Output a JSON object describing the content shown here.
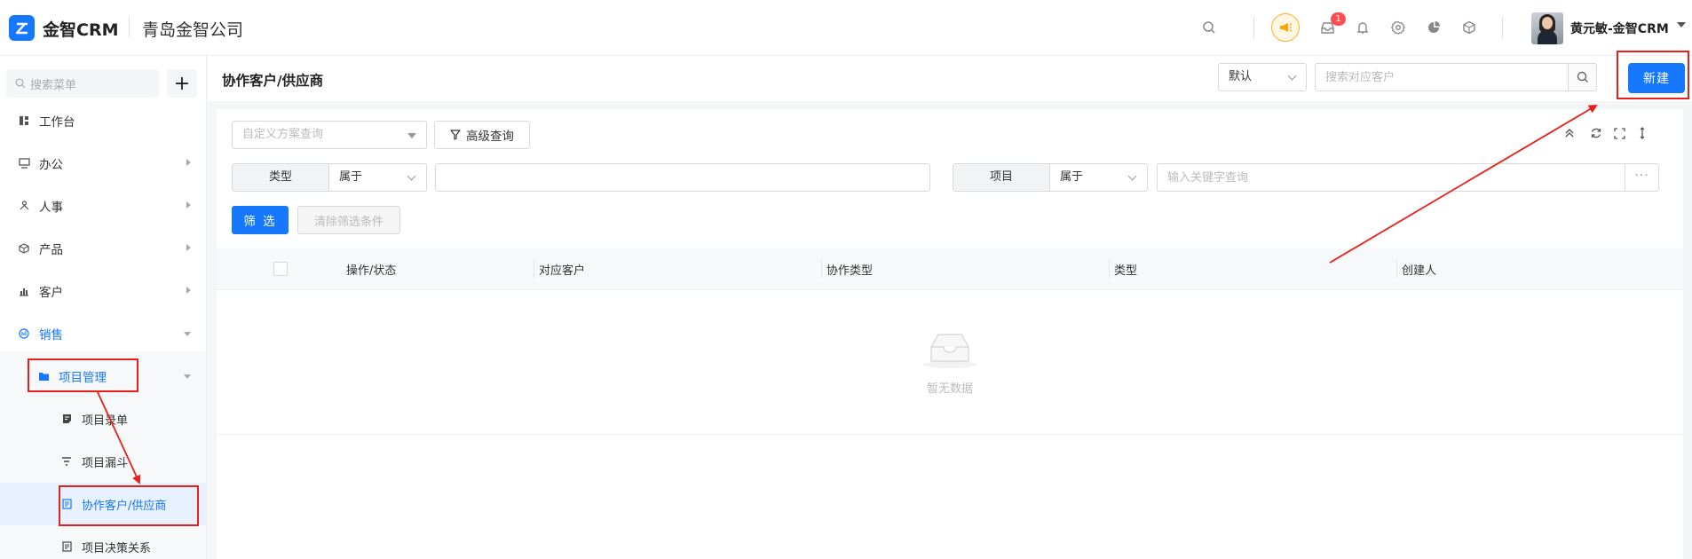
{
  "header": {
    "logo_text": "金智CRM",
    "company": "青岛金智公司",
    "notification_count": "1",
    "username": "黄元敏-金智CRM",
    "icons": [
      "search-icon",
      "announcement-icon",
      "inbox-icon",
      "bell-icon",
      "gear-icon",
      "pie-chart-icon",
      "cube-icon"
    ]
  },
  "sidebar": {
    "search_placeholder": "搜索菜单",
    "add_label": "+",
    "items": [
      {
        "label": "工作台",
        "icon": "dashboard-icon"
      },
      {
        "label": "办公",
        "icon": "monitor-icon"
      },
      {
        "label": "人事",
        "icon": "org-icon"
      },
      {
        "label": "产品",
        "icon": "box-icon"
      },
      {
        "label": "客户",
        "icon": "chart-bar-icon"
      },
      {
        "label": "销售",
        "icon": "sales-icon"
      }
    ],
    "sub_group": {
      "label": "项目管理",
      "icon": "folder-icon"
    },
    "leaves": [
      {
        "label": "项目录单",
        "icon": "note-icon"
      },
      {
        "label": "项目漏斗",
        "icon": "funnel-icon"
      },
      {
        "label": "协作客户/供应商",
        "icon": "doc-icon"
      },
      {
        "label": "项目决策关系",
        "icon": "doc-icon"
      }
    ]
  },
  "main": {
    "title": "协作客户/供应商",
    "sort_select": "默认",
    "search_placeholder": "搜索对应客户",
    "new_button": "新建",
    "plan_placeholder": "自定义方案查询",
    "advanced_query": "高级查询",
    "conditions": [
      {
        "label": "类型",
        "operator": "属于",
        "value": "",
        "placeholder": ""
      },
      {
        "label": "项目",
        "operator": "属于",
        "value": "",
        "placeholder": "输入关键字查询"
      }
    ],
    "more": "···",
    "filter_button": "筛 选",
    "clear_button": "清除筛选条件",
    "table": {
      "columns": [
        "操作/状态",
        "对应客户",
        "协作类型",
        "类型",
        "创建人"
      ],
      "empty_text": "暂无数据"
    }
  },
  "colors": {
    "accent": "#1677ff",
    "annotation": "#e8201a",
    "badge": "#ff4d4f"
  }
}
